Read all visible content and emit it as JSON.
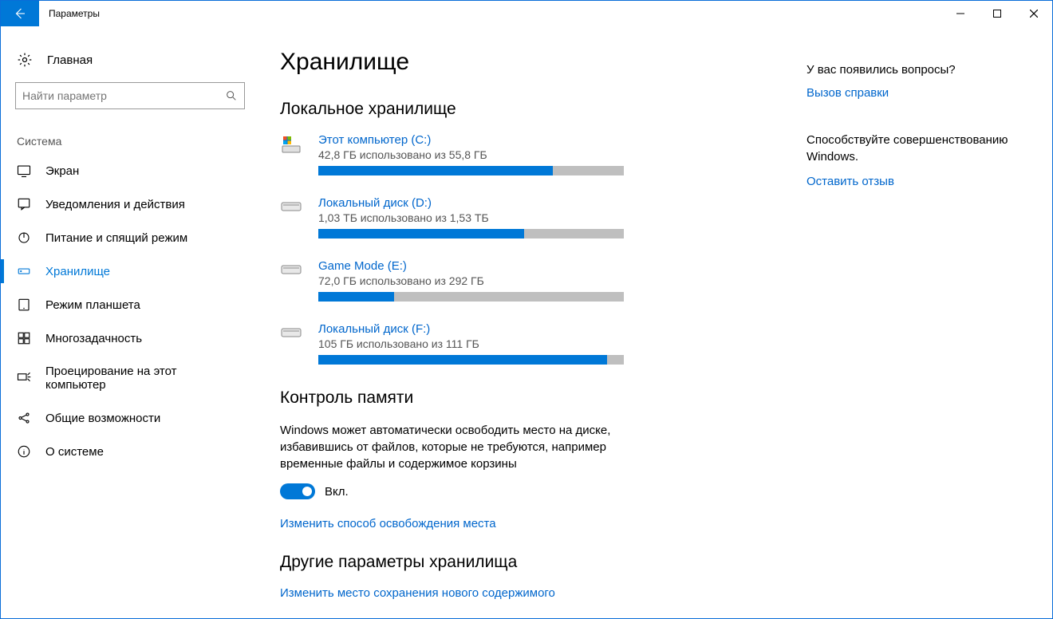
{
  "window_title": "Параметры",
  "sidebar": {
    "home_label": "Главная",
    "search_placeholder": "Найти параметр",
    "section_label": "Система",
    "items": [
      {
        "label": "Экран"
      },
      {
        "label": "Уведомления и действия"
      },
      {
        "label": "Питание и спящий режим"
      },
      {
        "label": "Хранилище"
      },
      {
        "label": "Режим планшета"
      },
      {
        "label": "Многозадачность"
      },
      {
        "label": "Проецирование на этот компьютер"
      },
      {
        "label": "Общие возможности"
      },
      {
        "label": "О системе"
      }
    ]
  },
  "main": {
    "page_title": "Хранилище",
    "local_storage_title": "Локальное хранилище",
    "drives": [
      {
        "name": "Этот компьютер (C:)",
        "usage": "42,8 ГБ использовано из 55,8 ГБ",
        "fill": 76.7
      },
      {
        "name": "Локальный диск (D:)",
        "usage": "1,03 ТБ использовано из 1,53 ТБ",
        "fill": 67.3
      },
      {
        "name": "Game Mode (E:)",
        "usage": "72,0 ГБ использовано из 292 ГБ",
        "fill": 24.7
      },
      {
        "name": "Локальный диск (F:)",
        "usage": "105 ГБ использовано из 111 ГБ",
        "fill": 94.6
      }
    ],
    "storage_sense_title": "Контроль памяти",
    "storage_sense_desc": "Windows может автоматически освободить место на диске, избавившись от файлов, которые не требуются, например временные файлы и содержимое корзины",
    "toggle_label": "Вкл.",
    "change_link": "Изменить способ освобождения места",
    "other_title": "Другие параметры хранилища",
    "other_link": "Изменить место сохранения нового содержимого"
  },
  "right": {
    "q_heading": "У вас появились вопросы?",
    "q_link": "Вызов справки",
    "f_text": "Способствуйте совершенствованию Windows.",
    "f_link": "Оставить отзыв"
  }
}
